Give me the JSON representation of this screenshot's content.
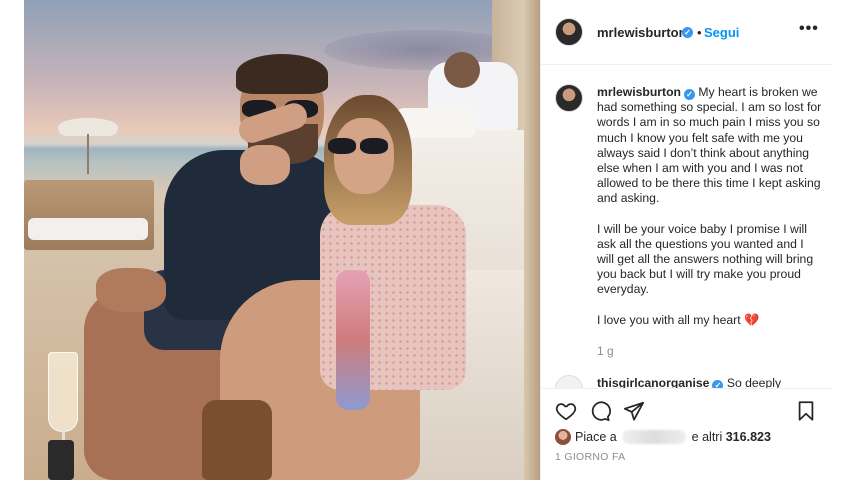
{
  "post": {
    "author": "mrlewisburton",
    "follow_label": "Segui",
    "separator": "•",
    "more_label": "•••",
    "caption": {
      "line1": "My heart is broken we had something so special. I am so lost for words I am in so much pain I miss you so much I know you felt safe with me you always said I don’t think about anything else when I am with you and I was not allowed to be there this time I kept asking and asking.",
      "line2": "I will be your voice baby I promise I will ask all the questions you wanted and I will get all the answers nothing will bring you back but I will try make you proud everyday.",
      "line3": "I love you with all my heart",
      "emoji": "💔"
    },
    "caption_time": "1 g",
    "next_comment_author": "thisgirlcanorganise",
    "next_comment_text": "So deeply",
    "likes_prefix": "Piace a",
    "likes_suffix": "e altri",
    "likes_count": "316.823",
    "posted_ago": "1 GIORNO FA"
  },
  "icons": {
    "like": "heart-outline",
    "comment": "speech-bubble",
    "share": "paper-plane",
    "save": "bookmark",
    "verified": "verified-badge"
  },
  "colors": {
    "link_blue": "#0095f6",
    "verified_blue": "#3897f0",
    "muted": "#8e8e8e",
    "text": "#262626"
  }
}
